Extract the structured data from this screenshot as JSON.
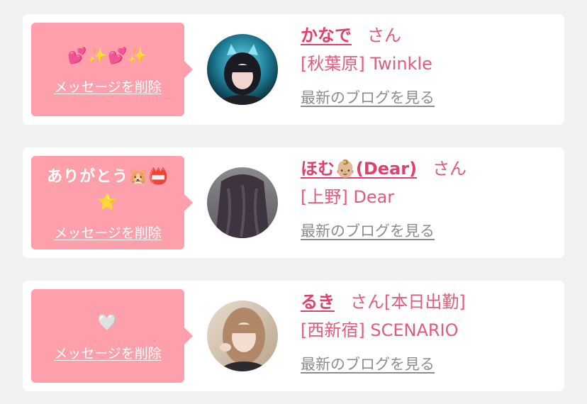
{
  "favorites": [
    {
      "message": "💕✨💕✨",
      "delete_label": "メッセージを削除",
      "name": "かなで",
      "honorific": "さん",
      "shop": "[秋葉原] Twinkle",
      "blog_link": "最新のブログを見る"
    },
    {
      "message": "ありがとう🐹📛⭐",
      "delete_label": "メッセージを削除",
      "name": "ほむ👶🏼(Dear)",
      "honorific": "さん",
      "shop": "[上野] Dear",
      "blog_link": "最新のブログを見る"
    },
    {
      "message": "🤍",
      "delete_label": "メッセージを削除",
      "name": "るき",
      "honorific": "さん[本日出勤]",
      "shop": "[西新宿] SCENARIO",
      "blog_link": "最新のブログを見る"
    }
  ],
  "colors": {
    "bubble": "#fea0ab",
    "accent": "#e0406a",
    "link_gray": "#8c8c8c"
  }
}
